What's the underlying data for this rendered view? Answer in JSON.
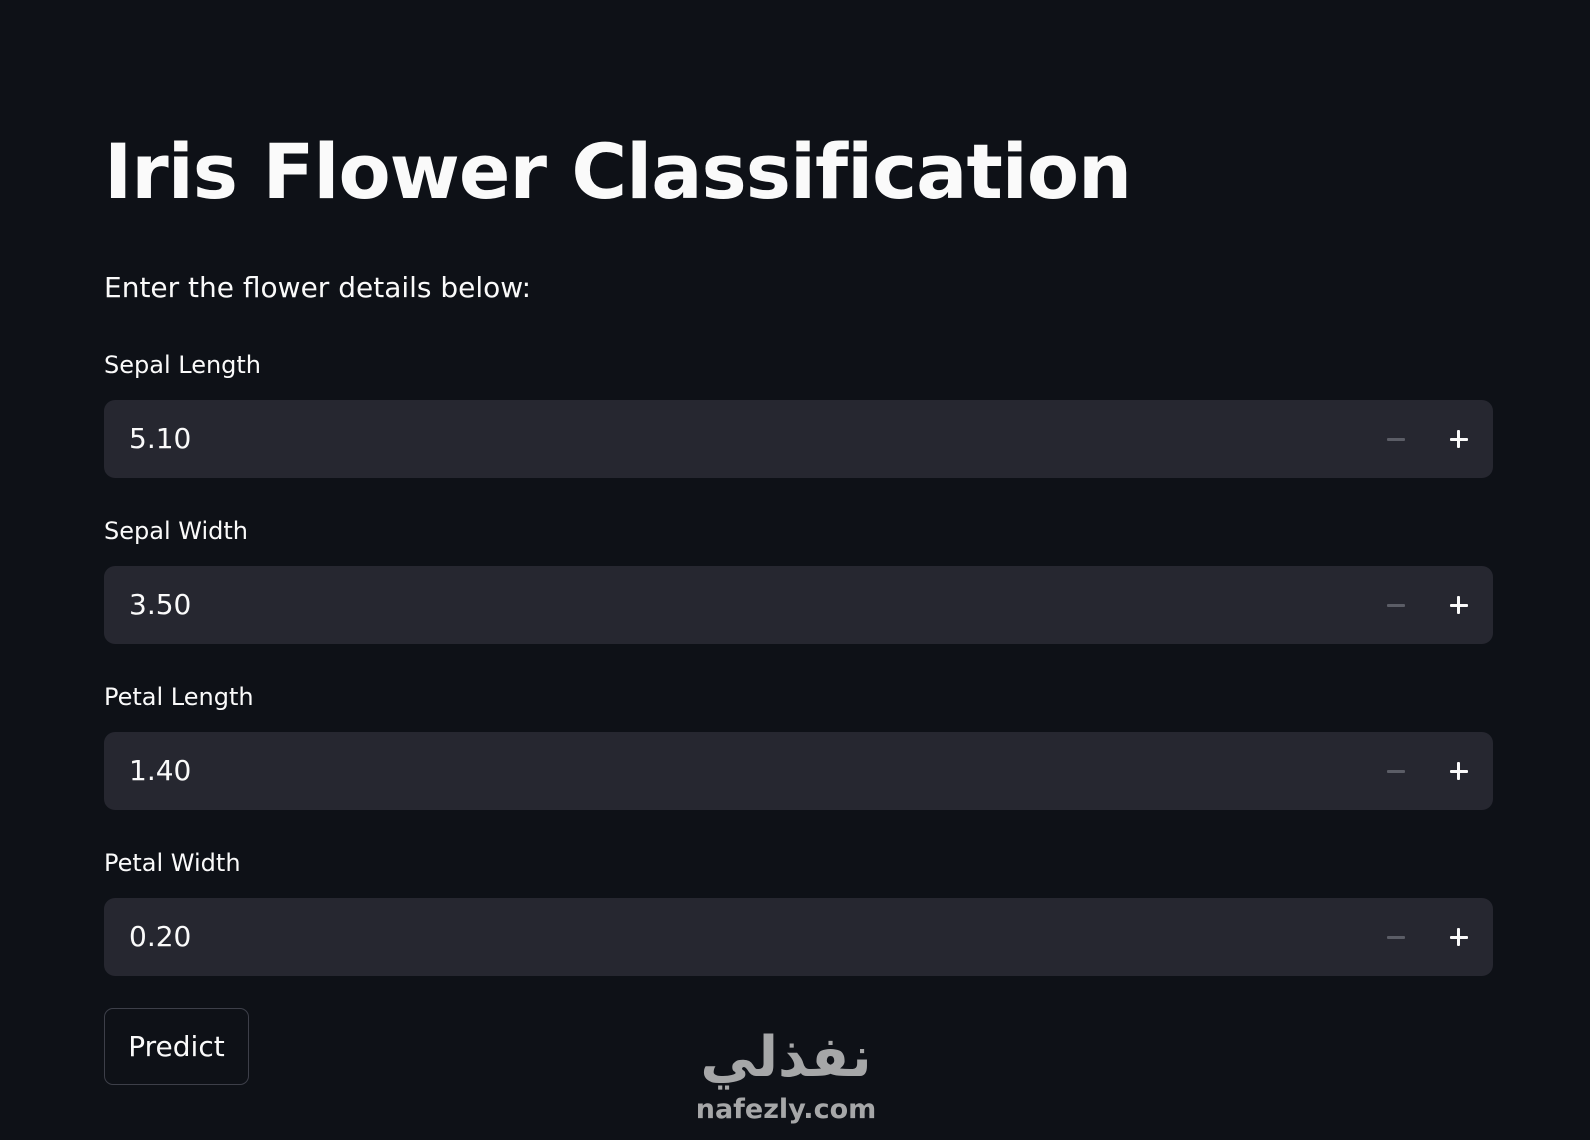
{
  "page": {
    "title": "Iris Flower Classification",
    "intro": "Enter the flower details below:"
  },
  "fields": [
    {
      "label": "Sepal Length",
      "value": "5.10"
    },
    {
      "label": "Sepal Width",
      "value": "3.50"
    },
    {
      "label": "Petal Length",
      "value": "1.40"
    },
    {
      "label": "Petal Width",
      "value": "0.20"
    }
  ],
  "actions": {
    "predict_label": "Predict"
  },
  "watermark": {
    "arabic_text": "نفذلي",
    "latin_text": "nafezly.com"
  },
  "colors": {
    "background": "#0e1117",
    "input_background": "#262730",
    "text": "#fafafa",
    "muted_icon": "#5b5d66",
    "button_border": "#3d3f49"
  }
}
